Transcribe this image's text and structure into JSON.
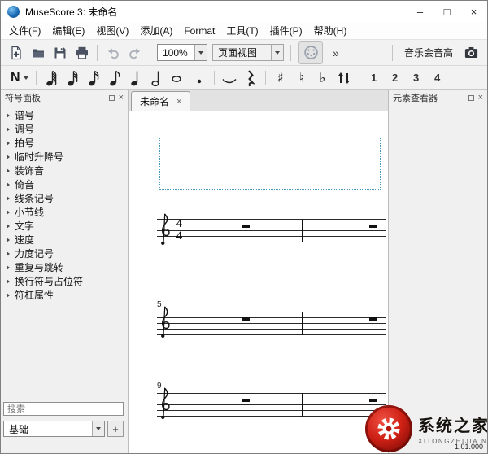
{
  "window": {
    "title": "MuseScore 3: 未命名"
  },
  "icons": {
    "minimize": "–",
    "maximize": "□",
    "close": "×",
    "close_small": "×",
    "overflow": "»",
    "toolbar_buttons": [
      "new-score-icon",
      "open-file-icon",
      "save-icon",
      "print-icon",
      "undo-icon",
      "redo-icon",
      "midi-input-icon",
      "concert-pitch",
      "camera-icon"
    ]
  },
  "menu": {
    "items": [
      "文件(F)",
      "编辑(E)",
      "视图(V)",
      "添加(A)",
      "Format",
      "工具(T)",
      "插件(P)",
      "帮助(H)"
    ]
  },
  "toolbar": {
    "zoom": "100%",
    "view_mode": "页面视图",
    "concert_pitch": "音乐会音高"
  },
  "note_input": {
    "label": "N",
    "buttons": [
      {
        "name": "note-64th-button",
        "kind": "note",
        "flags": 4
      },
      {
        "name": "note-32nd-button",
        "kind": "note",
        "flags": 3
      },
      {
        "name": "note-16th-button",
        "kind": "note",
        "flags": 2
      },
      {
        "name": "note-8th-button",
        "kind": "note",
        "flags": 1
      },
      {
        "name": "note-quarter-button",
        "kind": "note",
        "flags": 0
      },
      {
        "name": "note-half-button",
        "kind": "note",
        "hollow": true
      },
      {
        "name": "note-whole-button",
        "kind": "note",
        "hollow": true,
        "stemless": true
      },
      {
        "name": "augmentation-dot-button",
        "kind": "dot"
      },
      {
        "name": "separator",
        "kind": "sep"
      },
      {
        "name": "tie-button",
        "kind": "tie"
      },
      {
        "name": "rest-button",
        "kind": "rest"
      },
      {
        "name": "separator",
        "kind": "sep"
      },
      {
        "name": "sharp-button",
        "kind": "glyph",
        "glyph": "♯"
      },
      {
        "name": "natural-button",
        "kind": "glyph",
        "glyph": "♮"
      },
      {
        "name": "flat-button",
        "kind": "glyph",
        "glyph": "♭"
      },
      {
        "name": "flip-direction-button",
        "kind": "flip"
      },
      {
        "name": "separator",
        "kind": "sep"
      },
      {
        "name": "voice-1-button",
        "kind": "voice",
        "label": "1"
      },
      {
        "name": "voice-2-button",
        "kind": "voice",
        "label": "2"
      },
      {
        "name": "voice-3-button",
        "kind": "voice",
        "label": "3"
      },
      {
        "name": "voice-4-button",
        "kind": "voice",
        "label": "4"
      }
    ]
  },
  "panels": {
    "palette_title": "符号面板",
    "inspector_title": "元素查看器",
    "search_placeholder": "搜索",
    "workspace": "基础",
    "add_workspace": "+"
  },
  "palette": {
    "items": [
      "谱号",
      "调号",
      "拍号",
      "临时升降号",
      "装饰音",
      "倚音",
      "线条记号",
      "小节线",
      "文字",
      "速度",
      "力度记号",
      "重复与跳转",
      "换行符与占位符",
      "符杠属性"
    ]
  },
  "score": {
    "tab_label": "未命名",
    "time_signature": {
      "top": "4",
      "bottom": "4"
    },
    "systems": [
      {
        "measure_number": ""
      },
      {
        "measure_number": "5"
      },
      {
        "measure_number": "9"
      }
    ]
  },
  "status": {
    "position": "1.01.000"
  },
  "watermark": {
    "title": "系统之家",
    "subtitle": "XITONGZHIJIA.NET"
  }
}
